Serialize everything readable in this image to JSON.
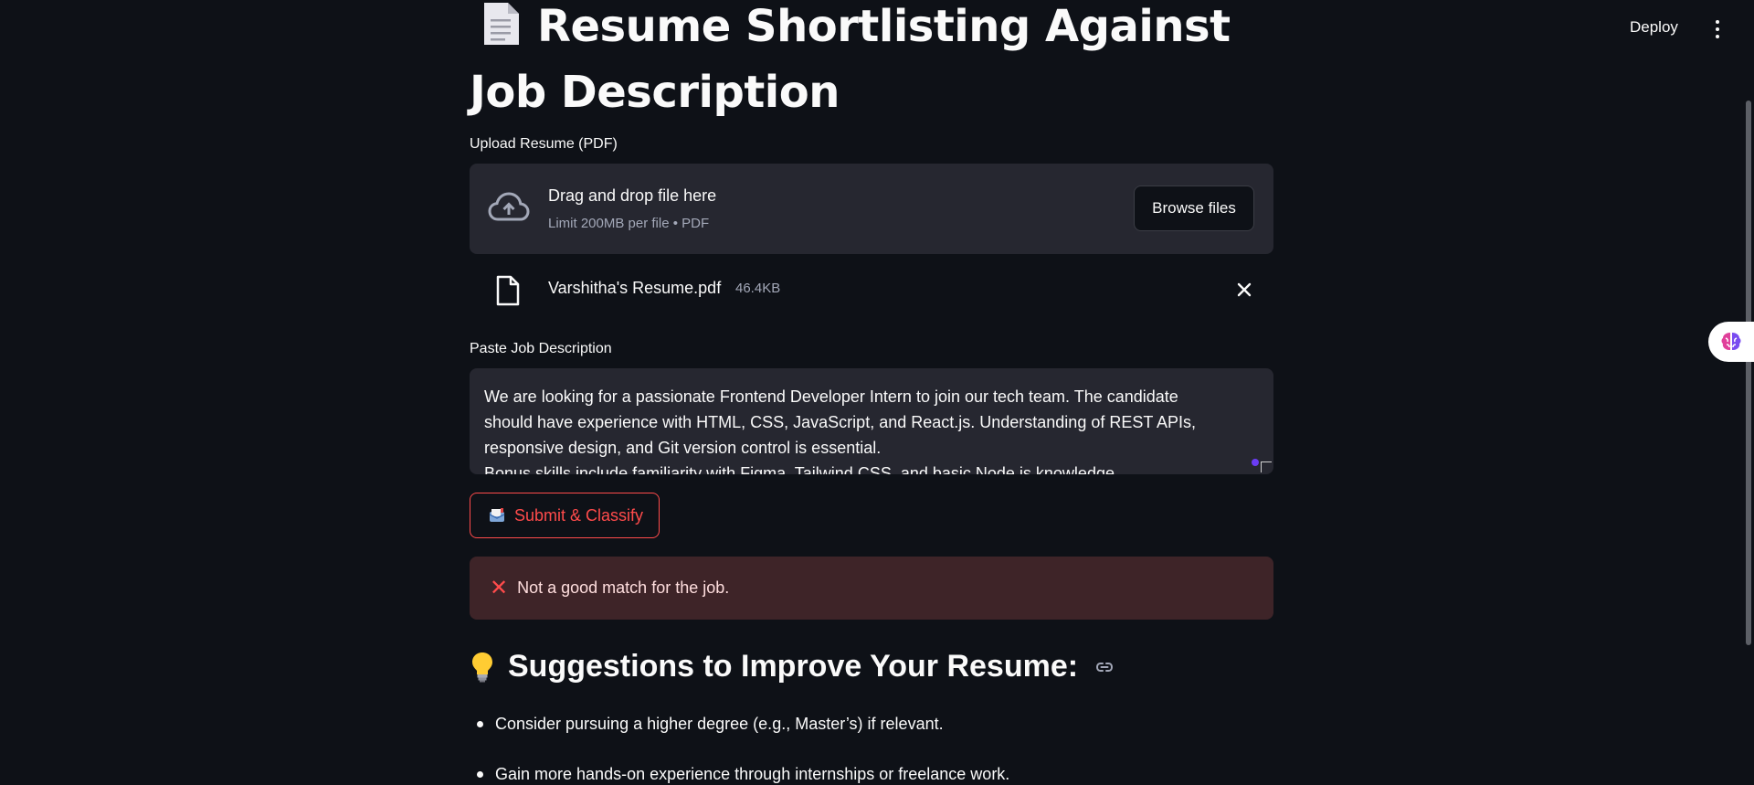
{
  "header": {
    "deploy_label": "Deploy",
    "menu_icon": "kebab-menu-icon"
  },
  "page": {
    "title": "Resume Shortlisting Against Job Description",
    "title_icon": "document-icon"
  },
  "uploader": {
    "label": "Upload Resume (PDF)",
    "dropzone_title": "Drag and drop file here",
    "dropzone_subtitle": "Limit 200MB per file • PDF",
    "browse_label": "Browse files",
    "file": {
      "name": "Varshitha's Resume.pdf",
      "size": "46.4KB"
    }
  },
  "job_description": {
    "label": "Paste Job Description",
    "value_lines": [
      "We are looking for a passionate Frontend Developer Intern to join our tech team. The candidate",
      "should have experience with HTML, CSS, JavaScript, and React.js. Understanding of REST APIs,",
      "responsive design, and Git version control is essential.",
      "Bonus skills include familiarity with Figma, Tailwind CSS, and basic Node.js knowledge."
    ]
  },
  "submit": {
    "label": "Submit & Classify",
    "icon": "mailbox-icon"
  },
  "result": {
    "message": "Not a good match for the job.",
    "icon": "cross-mark-icon",
    "color": "#ff4b4b"
  },
  "suggestions": {
    "heading": "Suggestions to Improve Your Resume:",
    "heading_icon": "light-bulb-icon",
    "items": [
      "Consider pursuing a higher degree (e.g., Master’s) if relevant.",
      "Gain more hands-on experience through internships or freelance work."
    ]
  },
  "colors": {
    "background": "#0e1117",
    "surface": "#262730",
    "accent": "#ff4b4b",
    "error_bg": "#3e2428"
  }
}
